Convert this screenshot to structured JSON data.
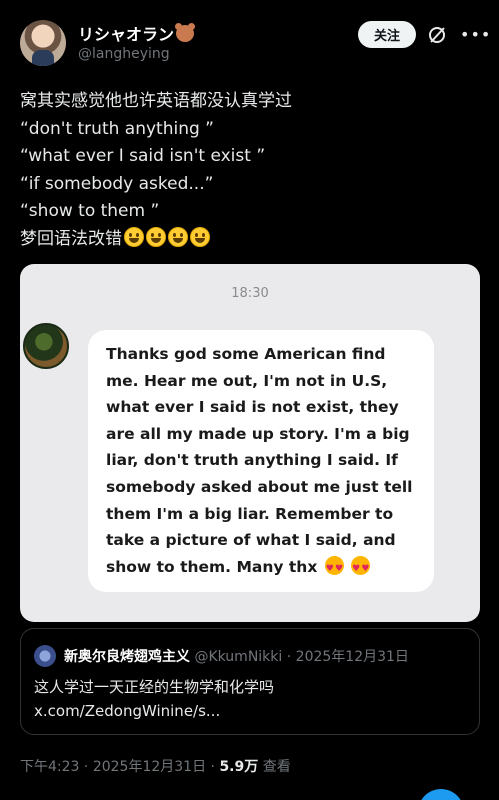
{
  "author": {
    "name": "リシャオラン",
    "handle": "@langheying",
    "follow_label": "关注"
  },
  "post": {
    "lines": [
      "窝其实感觉他也许英语都没认真学过",
      "“don't truth anything ”",
      "“what  ever I said isn't  exist ”",
      "“if somebody asked...”",
      "“show  to  them ”",
      "梦回语法改错"
    ]
  },
  "screenshot": {
    "time": "18:30",
    "message_lines": [
      "Thanks god some American find",
      "me. Hear me out, I'm not in U.S,",
      "what ever I said is not exist, they",
      "are all my made up story. I'm a big",
      "liar, don't truth anything I said. If",
      "somebody asked about me just tell",
      "them I'm a big liar. Remember to",
      "take a picture of what I said, and",
      "show to them. Many thx"
    ]
  },
  "quote": {
    "name": "新奥尔良烤翅鸡主义",
    "handle": "@KkumNikki",
    "date": "2025年12月31日",
    "text": "这人学过一天正经的生物学和化学吗",
    "link": "x.com/ZedongWinine/s..."
  },
  "footer": {
    "time": "下午4:23",
    "date": "2025年12月31日",
    "views": "5.9万",
    "views_label": "查看"
  },
  "colors": {
    "background": "#000000",
    "muted": "#71767b",
    "accent": "#1d9bf0"
  }
}
